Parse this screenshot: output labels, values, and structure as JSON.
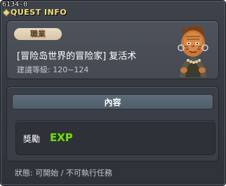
{
  "window": {
    "quest_id": "6134-0",
    "title": "QUEST INFO"
  },
  "header": {
    "category_badge": "職業",
    "quest_name": "[冒险岛世界的冒险家] 复活术",
    "recommended_level": "建議等級: 120~124",
    "npc_icon": "npc-portrait-icon"
  },
  "content": {
    "section_label": "內容",
    "reward_label": "獎勵",
    "reward_icon": "exp-icon",
    "reward_icon_text": "EXP"
  },
  "status": {
    "text": "狀態: 可開始 / 不可執行任務"
  },
  "colors": {
    "title": "#f6e27a",
    "exp_green": "#7cd620",
    "badge_bg": "#e2d2b6"
  }
}
